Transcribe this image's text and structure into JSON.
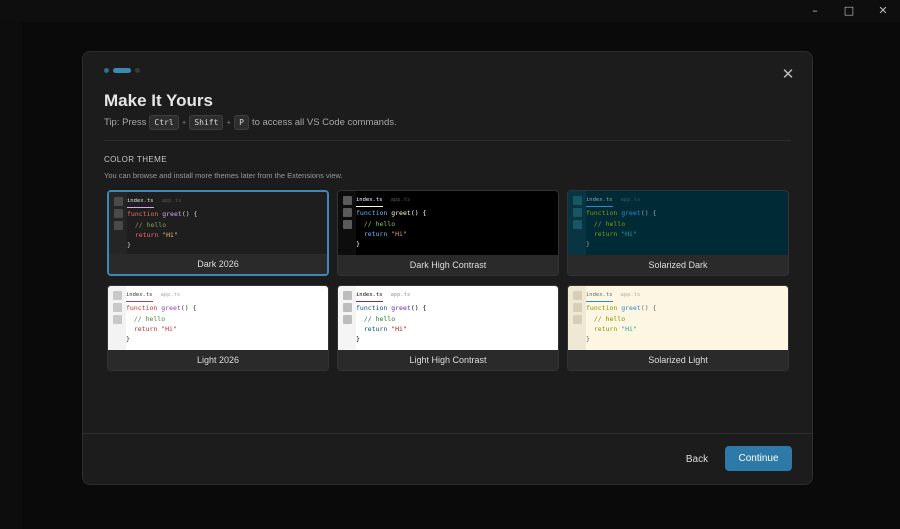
{
  "window": {
    "minimize_icon": "minimize-icon",
    "maximize_icon": "maximize-icon",
    "close_icon": "close-icon"
  },
  "dialog": {
    "steps": 3,
    "active_step": 2,
    "title": "Make It Yours",
    "tip": {
      "prefix": "Tip: Press",
      "keys": [
        "Ctrl",
        "Shift",
        "P"
      ],
      "suffix": "to access all VS Code commands."
    },
    "section_label": "COLOR THEME",
    "section_description": "You can browse and install more themes later from the Extensions view.",
    "themes": [
      {
        "name": "Dark 2026",
        "selected": true,
        "colors": {
          "bg": "#1e1e1e",
          "gutter": "#252525",
          "sq": "#4a4a4a",
          "tab": "#e0e0e0",
          "tab_dim": "#555555",
          "kw": "#f06b6b",
          "fn": "#d9a6f5",
          "cm": "#7ea35d",
          "str": "#e8c07a",
          "ret": "#f06b6b",
          "plain": "#d4d4d4",
          "label_bg": "#2a2a2a"
        }
      },
      {
        "name": "Dark High Contrast",
        "selected": false,
        "colors": {
          "bg": "#000000",
          "gutter": "#0d0d0d",
          "sq": "#5a5a5a",
          "tab": "#ffffff",
          "tab_dim": "#555555",
          "kw": "#6fb9ff",
          "fn": "#ffffcc",
          "cm": "#8bc34a",
          "str": "#e8a07a",
          "ret": "#6fb9ff",
          "plain": "#ffffff",
          "label_bg": "#2a2a2a"
        }
      },
      {
        "name": "Solarized Dark",
        "selected": false,
        "colors": {
          "bg": "#002b36",
          "gutter": "#073642",
          "sq": "#1a5564",
          "tab": "#93a1a1",
          "tab_dim": "#2a5a66",
          "kw": "#859900",
          "fn": "#268bd2",
          "cm": "#859900",
          "str": "#2aa198",
          "ret": "#859900",
          "plain": "#93a1a1",
          "label_bg": "#2a2a2a"
        }
      },
      {
        "name": "Light 2026",
        "selected": false,
        "colors": {
          "bg": "#ffffff",
          "gutter": "#f3f3f3",
          "sq": "#c8c8c8",
          "tab": "#333333",
          "tab_dim": "#aaaaaa",
          "kw": "#c42b2b",
          "fn": "#8a3fbf",
          "cm": "#4a8a3a",
          "str": "#c42b2b",
          "ret": "#c42b2b",
          "plain": "#333333",
          "label_bg": "#2a2a2a"
        }
      },
      {
        "name": "Light High Contrast",
        "selected": false,
        "colors": {
          "bg": "#ffffff",
          "gutter": "#f5f5f5",
          "sq": "#bdbdbd",
          "tab": "#000000",
          "tab_dim": "#999999",
          "kw": "#0f4a85",
          "fn": "#5e2ca5",
          "cm": "#2f7a2f",
          "str": "#a31515",
          "ret": "#0f4a85",
          "plain": "#000000",
          "label_bg": "#2a2a2a"
        }
      },
      {
        "name": "Solarized Light",
        "selected": false,
        "colors": {
          "bg": "#fdf6e3",
          "gutter": "#eee8d5",
          "sq": "#d6ceb5",
          "tab": "#586e75",
          "tab_dim": "#b5ad95",
          "kw": "#859900",
          "fn": "#268bd2",
          "cm": "#859900",
          "str": "#2aa198",
          "ret": "#859900",
          "plain": "#586e75",
          "label_bg": "#2a2a2a"
        }
      }
    ],
    "preview": {
      "tab_active": "index.ts",
      "tab_inactive": "app.ts",
      "keyword": "function",
      "func_name": "greet",
      "parens": "() {",
      "comment": "// hello",
      "return_kw": "return",
      "string": "\"Hi\"",
      "close_brace": "}"
    },
    "buttons": {
      "back": "Back",
      "continue": "Continue"
    }
  },
  "accent_color": "#2d7aa8"
}
